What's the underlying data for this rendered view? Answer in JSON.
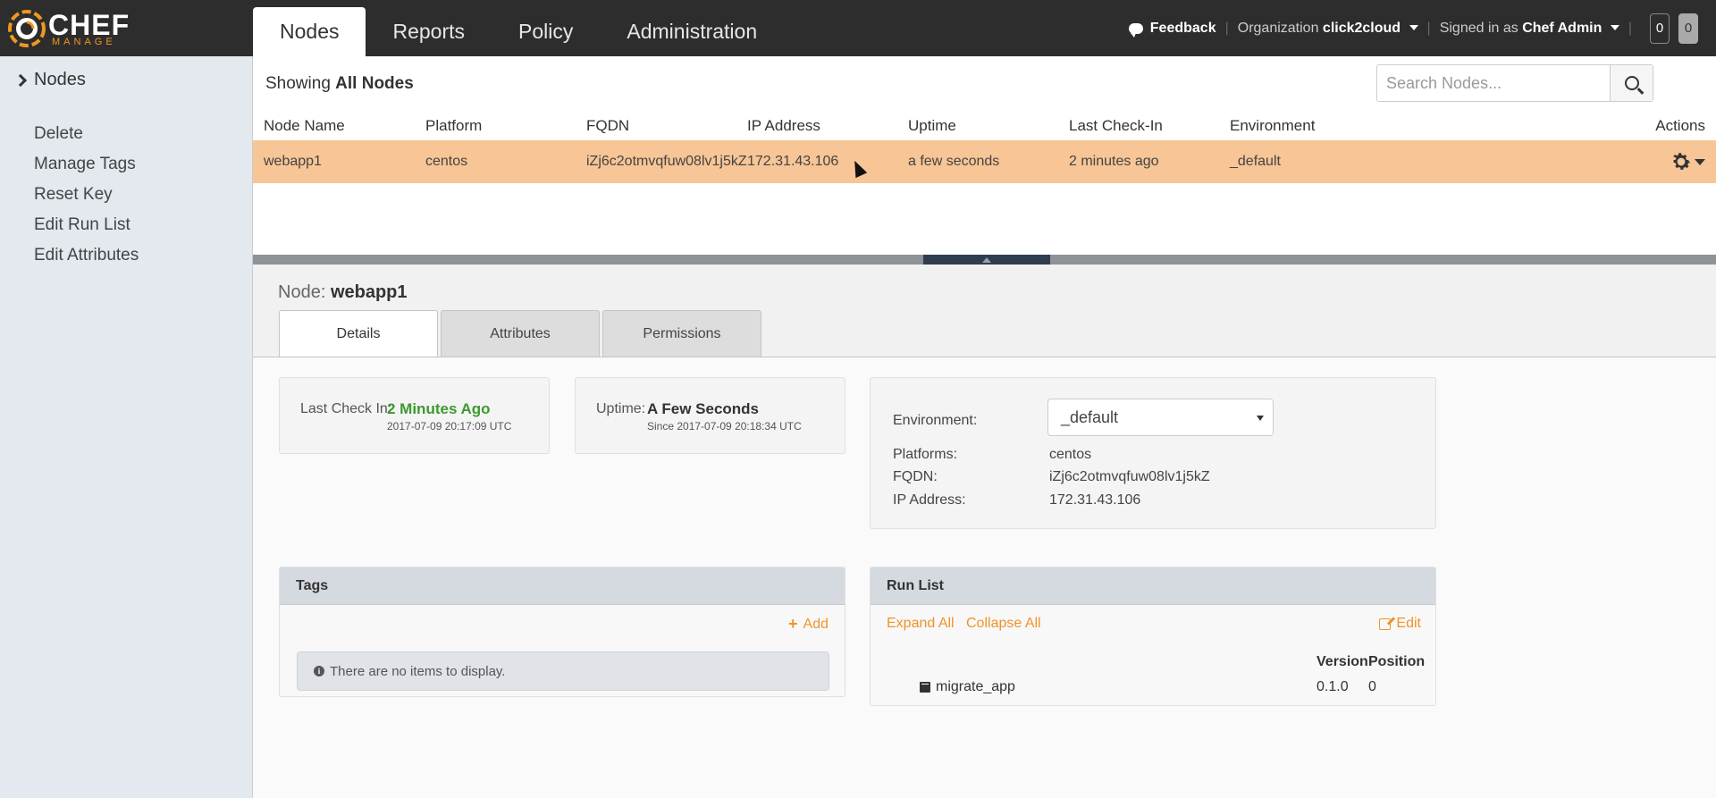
{
  "brand": {
    "title": "CHEF",
    "subtitle": "MANAGE"
  },
  "top_nav": {
    "tabs": [
      "Nodes",
      "Reports",
      "Policy",
      "Administration"
    ],
    "feedback": "Feedback",
    "org_label": "Organization",
    "org_value": "click2cloud",
    "signed_label": "Signed in as",
    "signed_value": "Chef Admin",
    "badge1": "0",
    "badge2": "0"
  },
  "sidebar": {
    "heading": "Nodes",
    "items": [
      "Delete",
      "Manage Tags",
      "Reset Key",
      "Edit Run List",
      "Edit Attributes"
    ]
  },
  "list": {
    "showing_prefix": "Showing",
    "showing_value": "All Nodes",
    "search_placeholder": "Search Nodes...",
    "columns": [
      "Node Name",
      "Platform",
      "FQDN",
      "IP Address",
      "Uptime",
      "Last Check-In",
      "Environment",
      "Actions"
    ],
    "rows": [
      [
        "webapp1",
        "centos",
        "iZj6c2otmvqfuw08lv1j5kZ",
        "172.31.43.106",
        "a few seconds",
        "2 minutes ago",
        "_default"
      ]
    ]
  },
  "node": {
    "label": "Node:",
    "name": "webapp1",
    "tabs": [
      "Details",
      "Attributes",
      "Permissions"
    ],
    "last_checkin_label": "Last Check In:",
    "last_checkin_value": "2 Minutes Ago",
    "last_checkin_ts": "2017-07-09 20:17:09 UTC",
    "uptime_label": "Uptime:",
    "uptime_value": "A Few Seconds",
    "uptime_ts": "Since 2017-07-09 20:18:34 UTC",
    "environment_label": "Environment:",
    "environment_value": "_default",
    "platforms_label": "Platforms:",
    "platforms_value": "centos",
    "fqdn_label": "FQDN:",
    "fqdn_value": "iZj6c2otmvqfuw08lv1j5kZ",
    "ip_label": "IP Address:",
    "ip_value": "172.31.43.106"
  },
  "tags": {
    "title": "Tags",
    "add": "Add",
    "empty": "There are no items to display."
  },
  "run_list": {
    "title": "Run List",
    "expand": "Expand All",
    "collapse": "Collapse All",
    "edit": "Edit",
    "version_header": "Version",
    "position_header": "Position",
    "items": [
      {
        "name": "migrate_app",
        "version": "0.1.0",
        "position": "0"
      }
    ]
  },
  "colors": {
    "accent": "#f0932b",
    "row_highlight": "#f7c596",
    "success": "#3c9a2e",
    "topbar": "#2d2d2d"
  }
}
